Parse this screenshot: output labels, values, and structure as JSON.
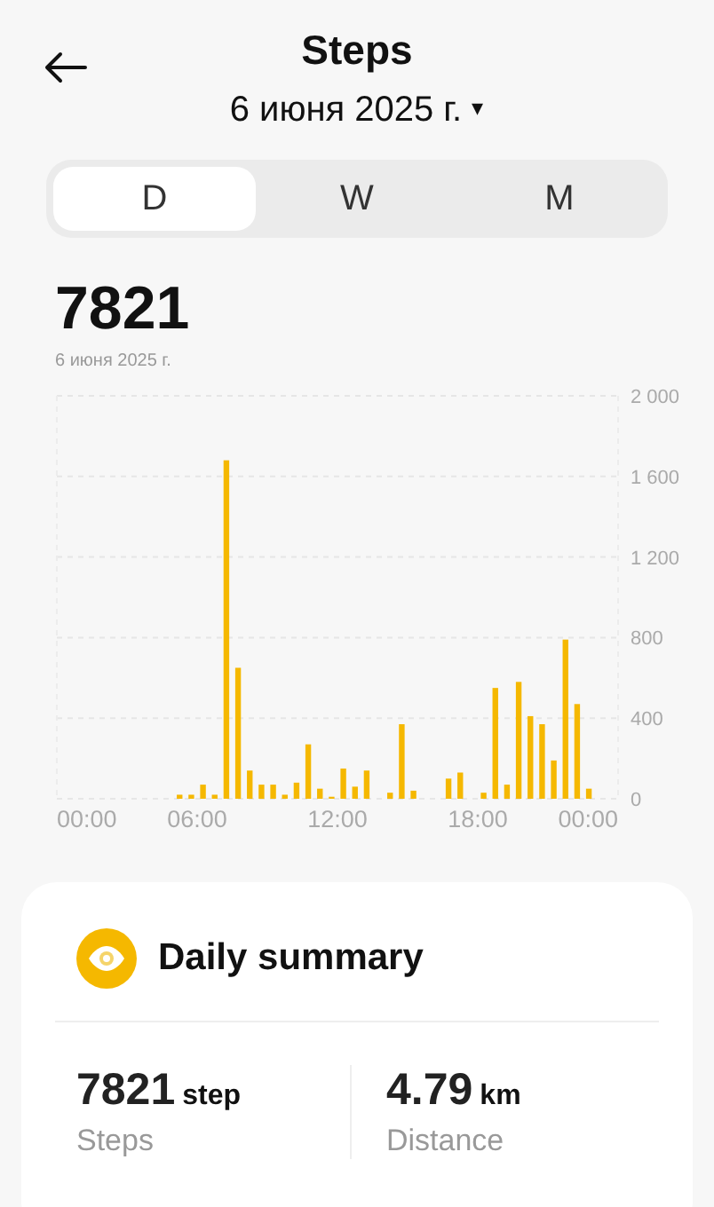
{
  "header": {
    "title": "Steps",
    "date": "6 июня 2025 г.",
    "date_caret": "▾"
  },
  "tabs": [
    {
      "label": "D",
      "selected": true
    },
    {
      "label": "W",
      "selected": false
    },
    {
      "label": "M",
      "selected": false
    }
  ],
  "total": {
    "value": "7821",
    "date": "6 июня 2025 г."
  },
  "chart": {
    "chart_data": {
      "type": "bar",
      "ylim": [
        0,
        2000
      ],
      "grid": true,
      "x": [
        0.25,
        0.75,
        1.25,
        1.75,
        2.25,
        2.75,
        3.25,
        3.75,
        4.25,
        4.75,
        5.25,
        5.75,
        6.25,
        6.75,
        7.25,
        7.75,
        8.25,
        8.75,
        9.25,
        9.75,
        10.25,
        10.75,
        11.25,
        11.75,
        12.25,
        12.75,
        13.25,
        13.75,
        14.25,
        14.75,
        15.25,
        15.75,
        16.25,
        16.75,
        17.25,
        17.75,
        18.25,
        18.75,
        19.25,
        19.75,
        20.25,
        20.75,
        21.25,
        21.75,
        22.25,
        22.75,
        23.25,
        23.75
      ],
      "yticks": [
        {
          "value": 0,
          "label": "0"
        },
        {
          "value": 400,
          "label": "400"
        },
        {
          "value": 800,
          "label": "800"
        },
        {
          "value": 1200,
          "label": "1 200"
        },
        {
          "value": 1600,
          "label": "1 600"
        },
        {
          "value": 2000,
          "label": "2 000"
        }
      ],
      "xlim": [
        0,
        24
      ],
      "xticks": [
        {
          "value": 0,
          "label": "00:00"
        },
        {
          "value": 6,
          "label": "06:00"
        },
        {
          "value": 12,
          "label": "12:00"
        },
        {
          "value": 18,
          "label": "18:00"
        },
        {
          "value": 24,
          "label": "00:00"
        }
      ],
      "series": [
        {
          "color": "#f5b800",
          "values": [
            0,
            0,
            0,
            0,
            0,
            0,
            0,
            0,
            0,
            0,
            20,
            20,
            70,
            20,
            1680,
            650,
            140,
            70,
            70,
            20,
            80,
            270,
            50,
            10,
            150,
            60,
            140,
            0,
            30,
            370,
            40,
            0,
            0,
            100,
            130,
            0,
            30,
            550,
            70,
            580,
            410,
            370,
            190,
            790,
            470,
            50,
            0,
            0
          ]
        }
      ]
    }
  },
  "summary": {
    "title": "Daily summary",
    "stats": [
      {
        "value": "7821",
        "unit": "step",
        "label": "Steps"
      },
      {
        "value": "4.79",
        "unit": "km",
        "label": "Distance"
      }
    ]
  }
}
